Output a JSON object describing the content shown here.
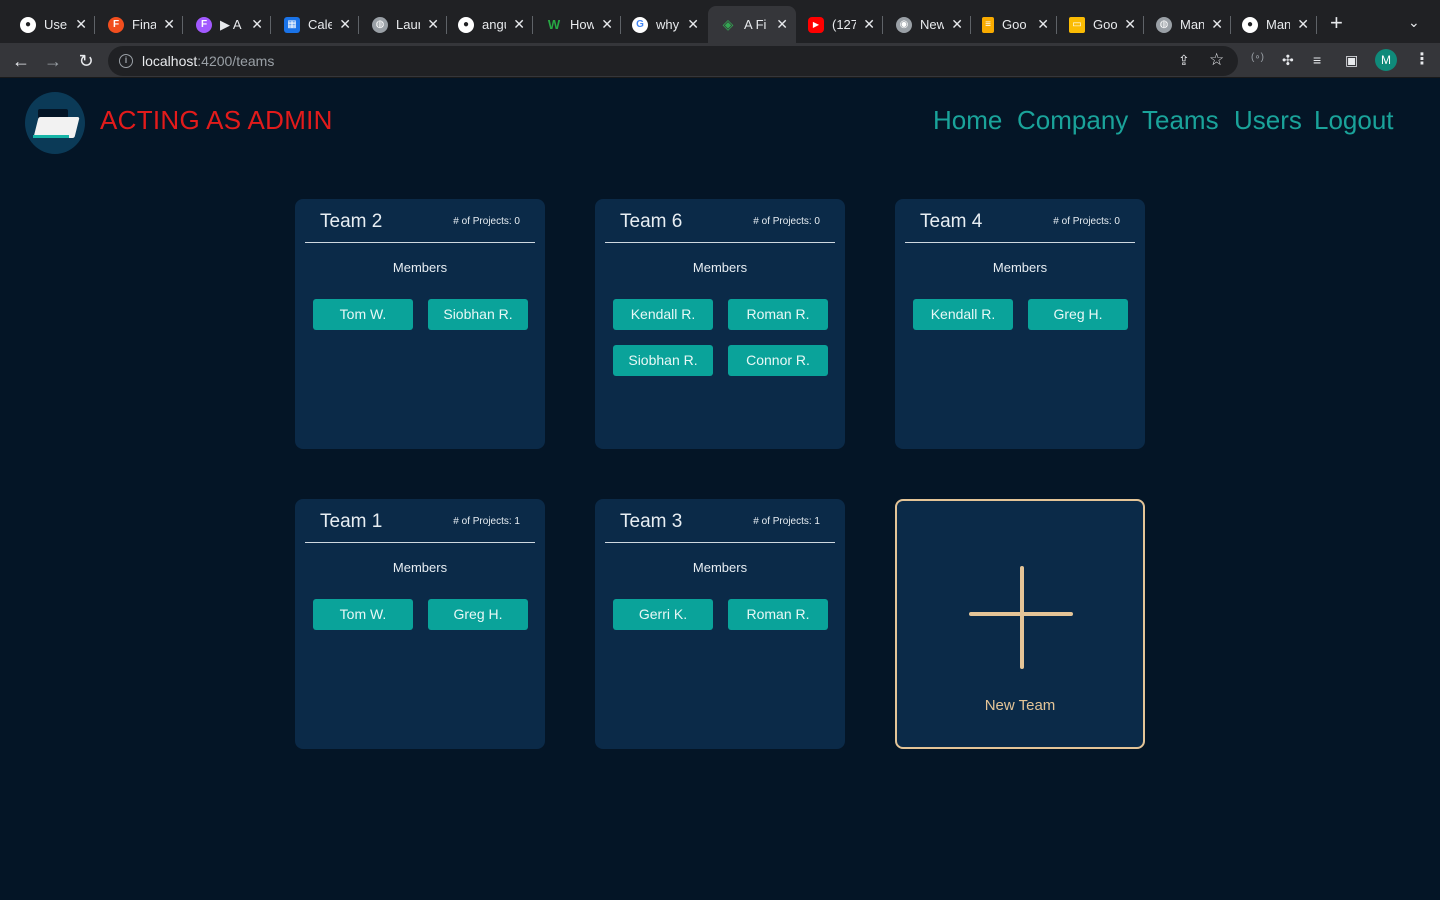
{
  "browser": {
    "tabs": [
      {
        "title": "User",
        "icon": "github-icon",
        "color": "#ffffff"
      },
      {
        "title": "Final",
        "icon": "figma-icon",
        "color": "#f24e1e"
      },
      {
        "title": "▶ A",
        "icon": "figma-icon",
        "color": "#a259ff"
      },
      {
        "title": "Cale",
        "icon": "calendar-icon",
        "color": "#1a73e8"
      },
      {
        "title": "Laur",
        "icon": "globe-icon",
        "color": "#9aa0a6"
      },
      {
        "title": "angu",
        "icon": "github-icon",
        "color": "#ffffff"
      },
      {
        "title": "How",
        "icon": "w-icon",
        "color": "#27a844"
      },
      {
        "title": "why",
        "icon": "google-icon",
        "color": "#4285f4"
      },
      {
        "title": "A Fi",
        "icon": "cube-icon",
        "color": "#34a853",
        "active": true
      },
      {
        "title": "(127",
        "icon": "youtube-icon",
        "color": "#ff0000"
      },
      {
        "title": "New",
        "icon": "chrome-icon",
        "color": "#9aa0a6"
      },
      {
        "title": "Goo",
        "icon": "docs-icon",
        "color": "#f9ab00"
      },
      {
        "title": "Goo",
        "icon": "slides-icon",
        "color": "#fbbc04"
      },
      {
        "title": "Man",
        "icon": "globe-icon",
        "color": "#9aa0a6"
      },
      {
        "title": "Man",
        "icon": "github-icon",
        "color": "#ffffff"
      }
    ],
    "url_host": "localhost",
    "url_path": ":4200/teams",
    "profile_initial": "M"
  },
  "header": {
    "brand": "ACTING AS ADMIN",
    "nav": [
      "Home",
      "Company",
      "Teams",
      "Users",
      "Logout"
    ]
  },
  "teams": [
    {
      "name": "Team 2",
      "projects": "# of Projects: 0",
      "members_label": "Members",
      "members": [
        "Tom W.",
        "Siobhan R."
      ]
    },
    {
      "name": "Team 6",
      "projects": "# of Projects: 0",
      "members_label": "Members",
      "members": [
        "Kendall R.",
        "Roman R.",
        "Siobhan R.",
        "Connor R."
      ]
    },
    {
      "name": "Team 4",
      "projects": "# of Projects: 0",
      "members_label": "Members",
      "members": [
        "Kendall R.",
        "Greg H."
      ]
    },
    {
      "name": "Team 1",
      "projects": "# of Projects: 1",
      "members_label": "Members",
      "members": [
        "Tom W.",
        "Greg H."
      ]
    },
    {
      "name": "Team 3",
      "projects": "# of Projects: 1",
      "members_label": "Members",
      "members": [
        "Gerri K.",
        "Roman R."
      ]
    }
  ],
  "new_team": {
    "label": "New Team"
  },
  "colors": {
    "background": "#041526",
    "card": "#0b2a48",
    "chip": "#0aa39a",
    "nav": "#1aa39a",
    "brand": "#e31b1b",
    "accent": "#e4c497"
  }
}
